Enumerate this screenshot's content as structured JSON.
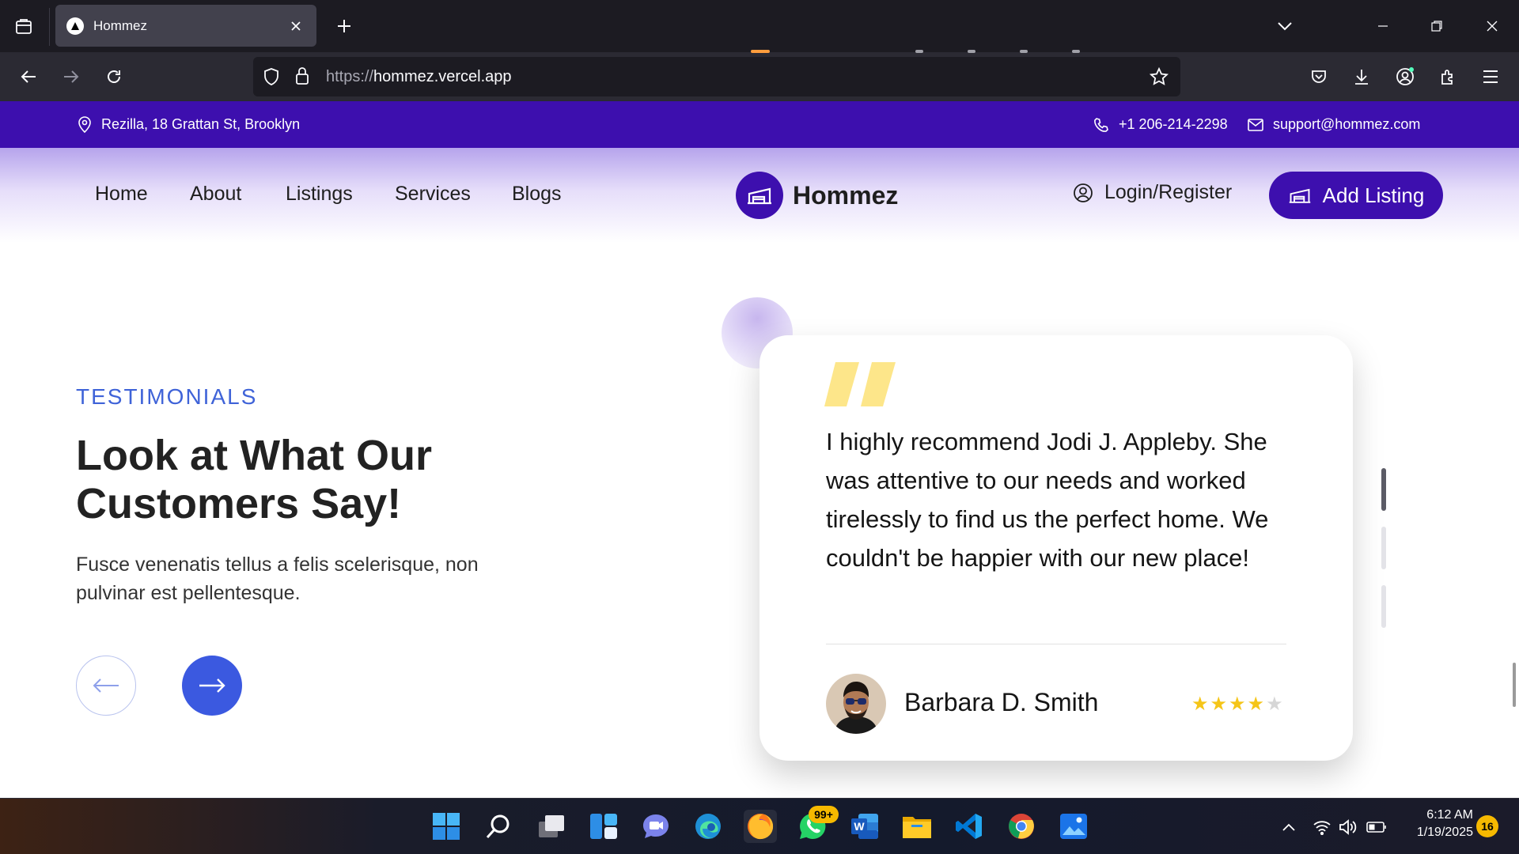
{
  "browser": {
    "tab_title": "Hommez",
    "url_protocol": "https://",
    "url_host": "hommez.vercel.app"
  },
  "topbar": {
    "address": "Rezilla, 18 Grattan St, Brooklyn",
    "phone": "+1 206-214-2298",
    "email": "support@hommez.com"
  },
  "header": {
    "menu": [
      "Home",
      "About",
      "Listings",
      "Services",
      "Blogs"
    ],
    "logo": "Hommez",
    "login": "Login/Register",
    "add_listing": "Add Listing"
  },
  "testimonials": {
    "tag": "TESTIMONIALS",
    "headline": "Look at What Our Customers Say!",
    "subtext": "Fusce venenatis tellus a felis scelerisque, non pulvinar est pellentesque.",
    "quote": "I highly recommend Jodi J. Appleby. She was attentive to our needs and worked tirelessly to find us the perfect home. We couldn't be happier with our new place!",
    "author": "Barbara D. Smith",
    "rating": 4,
    "rating_max": 5,
    "slides": 3,
    "active_slide": 1
  },
  "taskbar": {
    "whatsapp_badge": "99+",
    "time": "6:12 AM",
    "date": "1/19/2025",
    "notifications": "16"
  },
  "colors": {
    "brand_purple": "#3d0fae",
    "accent_blue": "#3b59e0",
    "tag_blue": "#3f63d8",
    "star_gold": "#f5c518",
    "quote_yellow": "#fde68a"
  }
}
